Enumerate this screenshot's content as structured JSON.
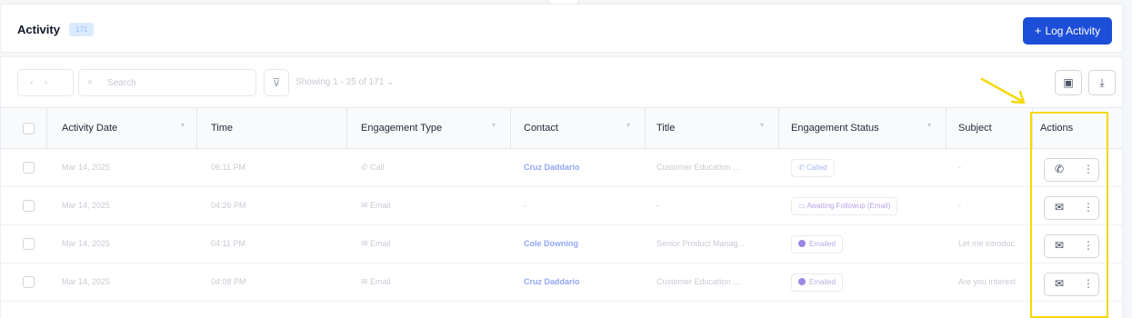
{
  "header": {
    "title": "Activity",
    "count": "171",
    "log_button": "Log Activity"
  },
  "toolbar": {
    "search_placeholder": "Search",
    "showing": "Showing 1 - 25 of 171"
  },
  "icons": {
    "prev": "chevron-left-icon",
    "next": "chevron-right-icon",
    "search": "search-icon",
    "filter": "filter-icon",
    "layout": "layout-icon",
    "download": "download-icon",
    "call": "phone-icon",
    "email": "mail-icon",
    "more": "more-vertical-icon"
  },
  "columns": [
    "Activity Date",
    "Time",
    "Engagement Type",
    "Contact",
    "Title",
    "Engagement Status",
    "Subject",
    "Actions"
  ],
  "rows": [
    {
      "date": "Mar 14, 2025",
      "time": "06:11 PM",
      "type": "Call",
      "contact": "Cruz Daddario",
      "title": "Customer Education ...",
      "status": "Called",
      "subject": "-"
    },
    {
      "date": "Mar 14, 2025",
      "time": "04:26 PM",
      "type": "Email",
      "contact": "-",
      "title": "-",
      "status": "Awaiting Followup (Email)",
      "subject": "-"
    },
    {
      "date": "Mar 14, 2025",
      "time": "04:11 PM",
      "type": "Email",
      "contact": "Cole Downing",
      "title": "Senior Product Manag...",
      "status": "Emailed",
      "subject": "Let me introduc"
    },
    {
      "date": "Mar 14, 2025",
      "time": "04:08 PM",
      "type": "Email",
      "contact": "Cruz Daddario",
      "title": "Customer Education ...",
      "status": "Emailed",
      "subject": "Are you interest"
    }
  ],
  "colors": {
    "accent": "#1d4ed8",
    "highlight": "#f5d90a"
  }
}
